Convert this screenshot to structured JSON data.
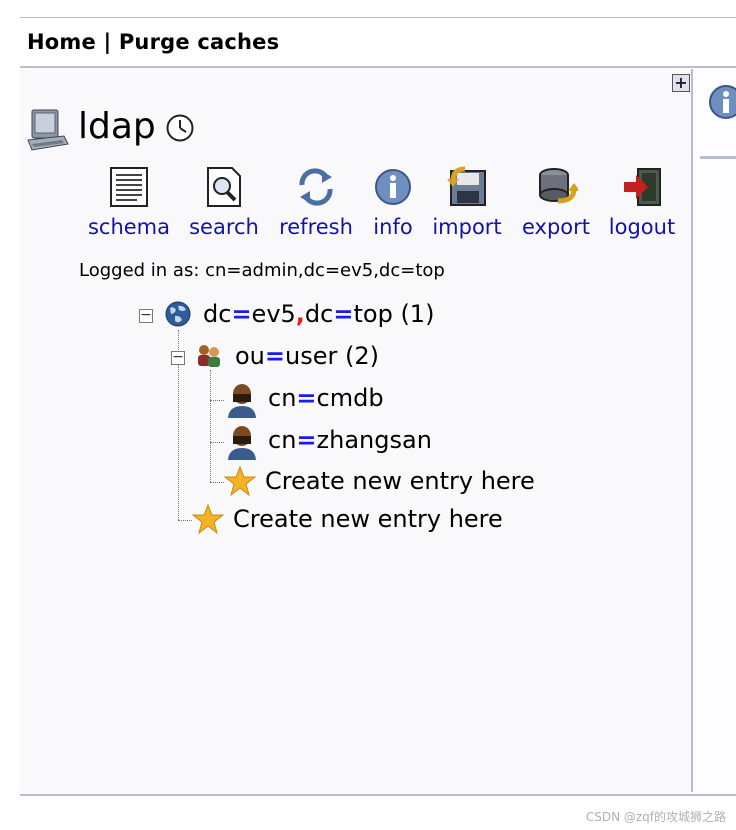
{
  "menu": {
    "home": "Home",
    "separator": "|",
    "purge": "Purge caches"
  },
  "expand_symbol": "+",
  "server": {
    "name": "ldap"
  },
  "toolbar": [
    {
      "label": "schema",
      "icon": "schema-icon"
    },
    {
      "label": "search",
      "icon": "search-icon"
    },
    {
      "label": "refresh",
      "icon": "refresh-icon"
    },
    {
      "label": "info",
      "icon": "info-icon"
    },
    {
      "label": "import",
      "icon": "import-icon"
    },
    {
      "label": "export",
      "icon": "export-icon"
    },
    {
      "label": "logout",
      "icon": "logout-icon"
    }
  ],
  "logged_in": "Logged in as: cn=admin,dc=ev5,dc=top",
  "tree": {
    "root": {
      "a": "dc",
      "b": "ev5",
      "c": "dc",
      "d": "top",
      "count": "(1)"
    },
    "ou": {
      "a": "ou",
      "b": "user",
      "count": "(2)"
    },
    "entries": [
      {
        "a": "cn",
        "b": "cmdb"
      },
      {
        "a": "cn",
        "b": "zhangsan"
      }
    ],
    "create_inner": "Create new entry here",
    "create_outer": "Create new entry here"
  },
  "watermark": "CSDN @zqf的攻城狮之路"
}
